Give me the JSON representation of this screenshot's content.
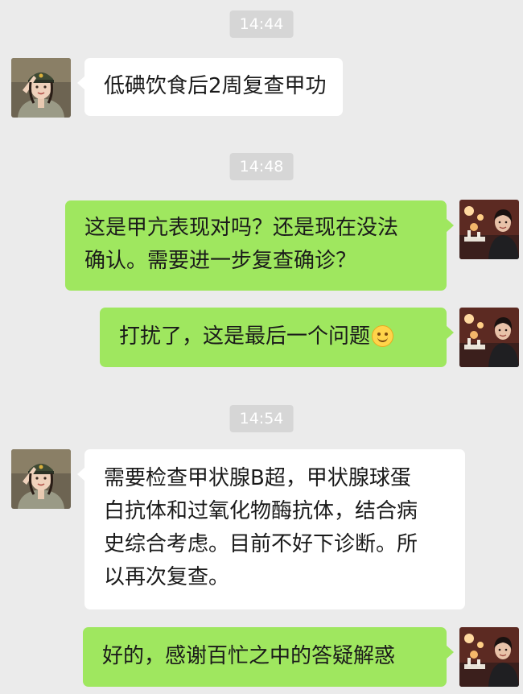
{
  "messages": [
    {
      "kind": "timestamp",
      "text": "14:44"
    },
    {
      "kind": "message",
      "side": "left",
      "avatar": "soldier-avatar",
      "lines": [
        "低碘饮食后2周复查甲功"
      ]
    },
    {
      "kind": "timestamp",
      "text": "14:48"
    },
    {
      "kind": "message",
      "side": "right",
      "avatar": "user-avatar",
      "lines": [
        "这是甲亢表现对吗？还是现在没法",
        "确认。需要进一步复查确诊？"
      ]
    },
    {
      "kind": "message",
      "side": "right",
      "avatar": "user-avatar",
      "lines": [
        "打扰了，这是最后一个问题"
      ],
      "emoji": "smiling-face-emoji"
    },
    {
      "kind": "timestamp",
      "text": "14:54"
    },
    {
      "kind": "message",
      "side": "left",
      "avatar": "soldier-avatar",
      "lines": [
        "需要检查甲状腺B超，甲状腺球蛋",
        "白抗体和过氧化物酶抗体，结合病",
        "史综合考虑。目前不好下诊断。所",
        "以再次复查。"
      ]
    },
    {
      "kind": "message",
      "side": "right",
      "avatar": "user-avatar",
      "lines": [
        "好的，感谢百忙之中的答疑解惑"
      ]
    }
  ],
  "colors": {
    "background": "#ebebeb",
    "incoming_bubble": "#ffffff",
    "outgoing_bubble": "#9fe75f",
    "timestamp_bg": "#d6d6d6"
  }
}
